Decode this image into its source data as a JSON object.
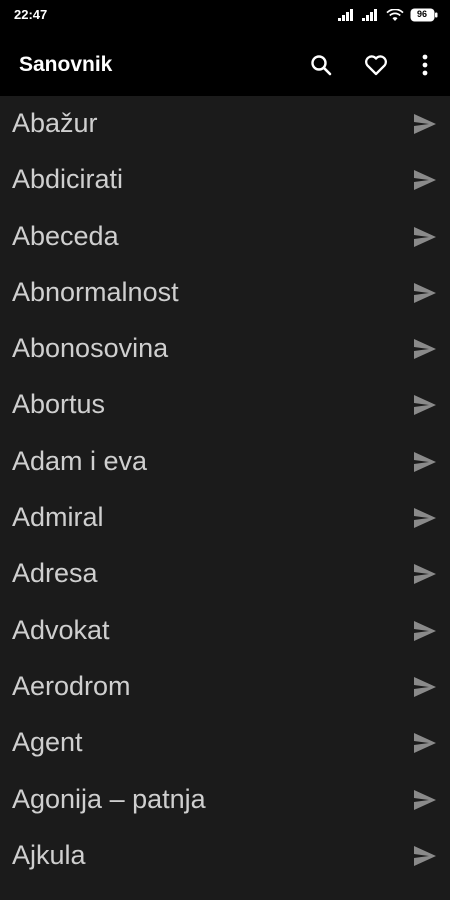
{
  "status_bar": {
    "time": "22:47",
    "battery": "96"
  },
  "app_bar": {
    "title": "Sanovnik",
    "actions": [
      "search-icon",
      "heart-icon",
      "more-vert-icon"
    ]
  },
  "list": {
    "items": [
      {
        "label": "Abažur"
      },
      {
        "label": "Abdicirati"
      },
      {
        "label": "Abeceda"
      },
      {
        "label": "Abnormalnost"
      },
      {
        "label": "Abonosovina"
      },
      {
        "label": "Abortus"
      },
      {
        "label": "Adam i eva"
      },
      {
        "label": "Admiral"
      },
      {
        "label": "Adresa"
      },
      {
        "label": "Advokat"
      },
      {
        "label": "Aerodrom"
      },
      {
        "label": "Agent"
      },
      {
        "label": "Agonija – patnja"
      },
      {
        "label": "Ajkula"
      }
    ]
  },
  "colors": {
    "status_bg": "#000000",
    "app_bar_bg": "#000000",
    "list_bg": "#1b1b1b",
    "item_text": "#cfcfcf",
    "send_icon": "#8a8a8a"
  }
}
